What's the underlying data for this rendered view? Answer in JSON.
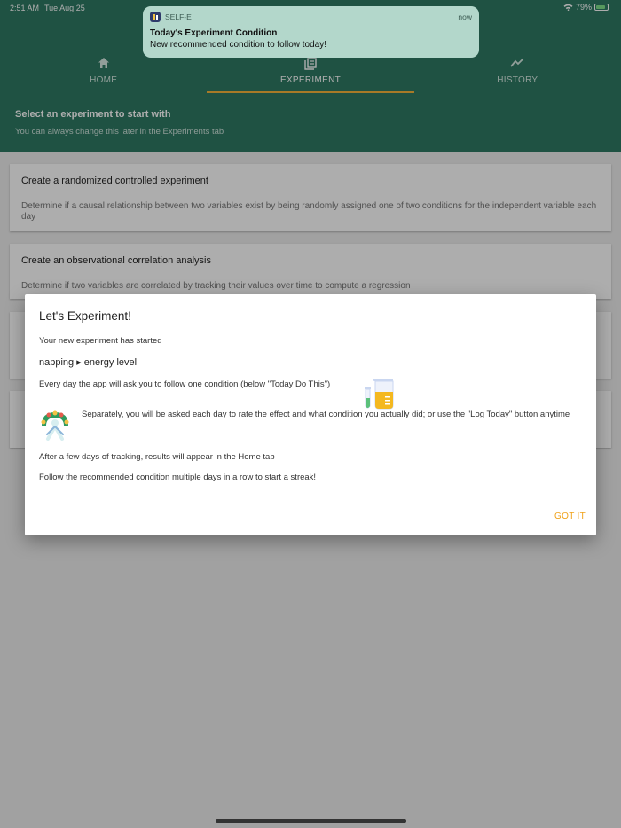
{
  "status": {
    "time": "2:51 AM",
    "date": "Tue Aug 25",
    "battery": "79%"
  },
  "tabs": [
    {
      "label": "HOME",
      "icon": "home-icon"
    },
    {
      "label": "EXPERIMENT",
      "icon": "experiment-icon"
    },
    {
      "label": "HISTORY",
      "icon": "history-icon"
    }
  ],
  "banner": {
    "title": "Select an experiment to start with",
    "subtitle": "You can always change this later in the Experiments tab"
  },
  "cards": [
    {
      "title": "Create a randomized controlled experiment",
      "desc": "Determine if a causal relationship between two variables exist by being randomly assigned one of two conditions for the independent variable each day"
    },
    {
      "title": "Create an observational correlation analysis",
      "desc": "Determine if two variables are correlated by tracking their values over time to compute a regression"
    }
  ],
  "notification": {
    "app": "SELF-E",
    "time": "now",
    "title": "Today's Experiment Condition",
    "body": "New recommended condition to follow today!"
  },
  "dialog": {
    "title": "Let's Experiment!",
    "started": "Your new experiment has started",
    "variables": "napping ▸ energy level",
    "every_day": "Every day the app will ask you to follow one condition (below \"Today Do This\")",
    "separately": "Separately, you will be asked each day to rate the effect and what condition you actually did; or use the \"Log Today\" button anytime",
    "after": "After a few days of tracking, results will appear in the Home tab",
    "streak": "Follow the recommended condition multiple days in a row to start a streak!",
    "button": "GOT IT"
  },
  "colors": {
    "primary": "#2e7a64",
    "accent": "#f6b43a",
    "button": "#f0a21a"
  }
}
